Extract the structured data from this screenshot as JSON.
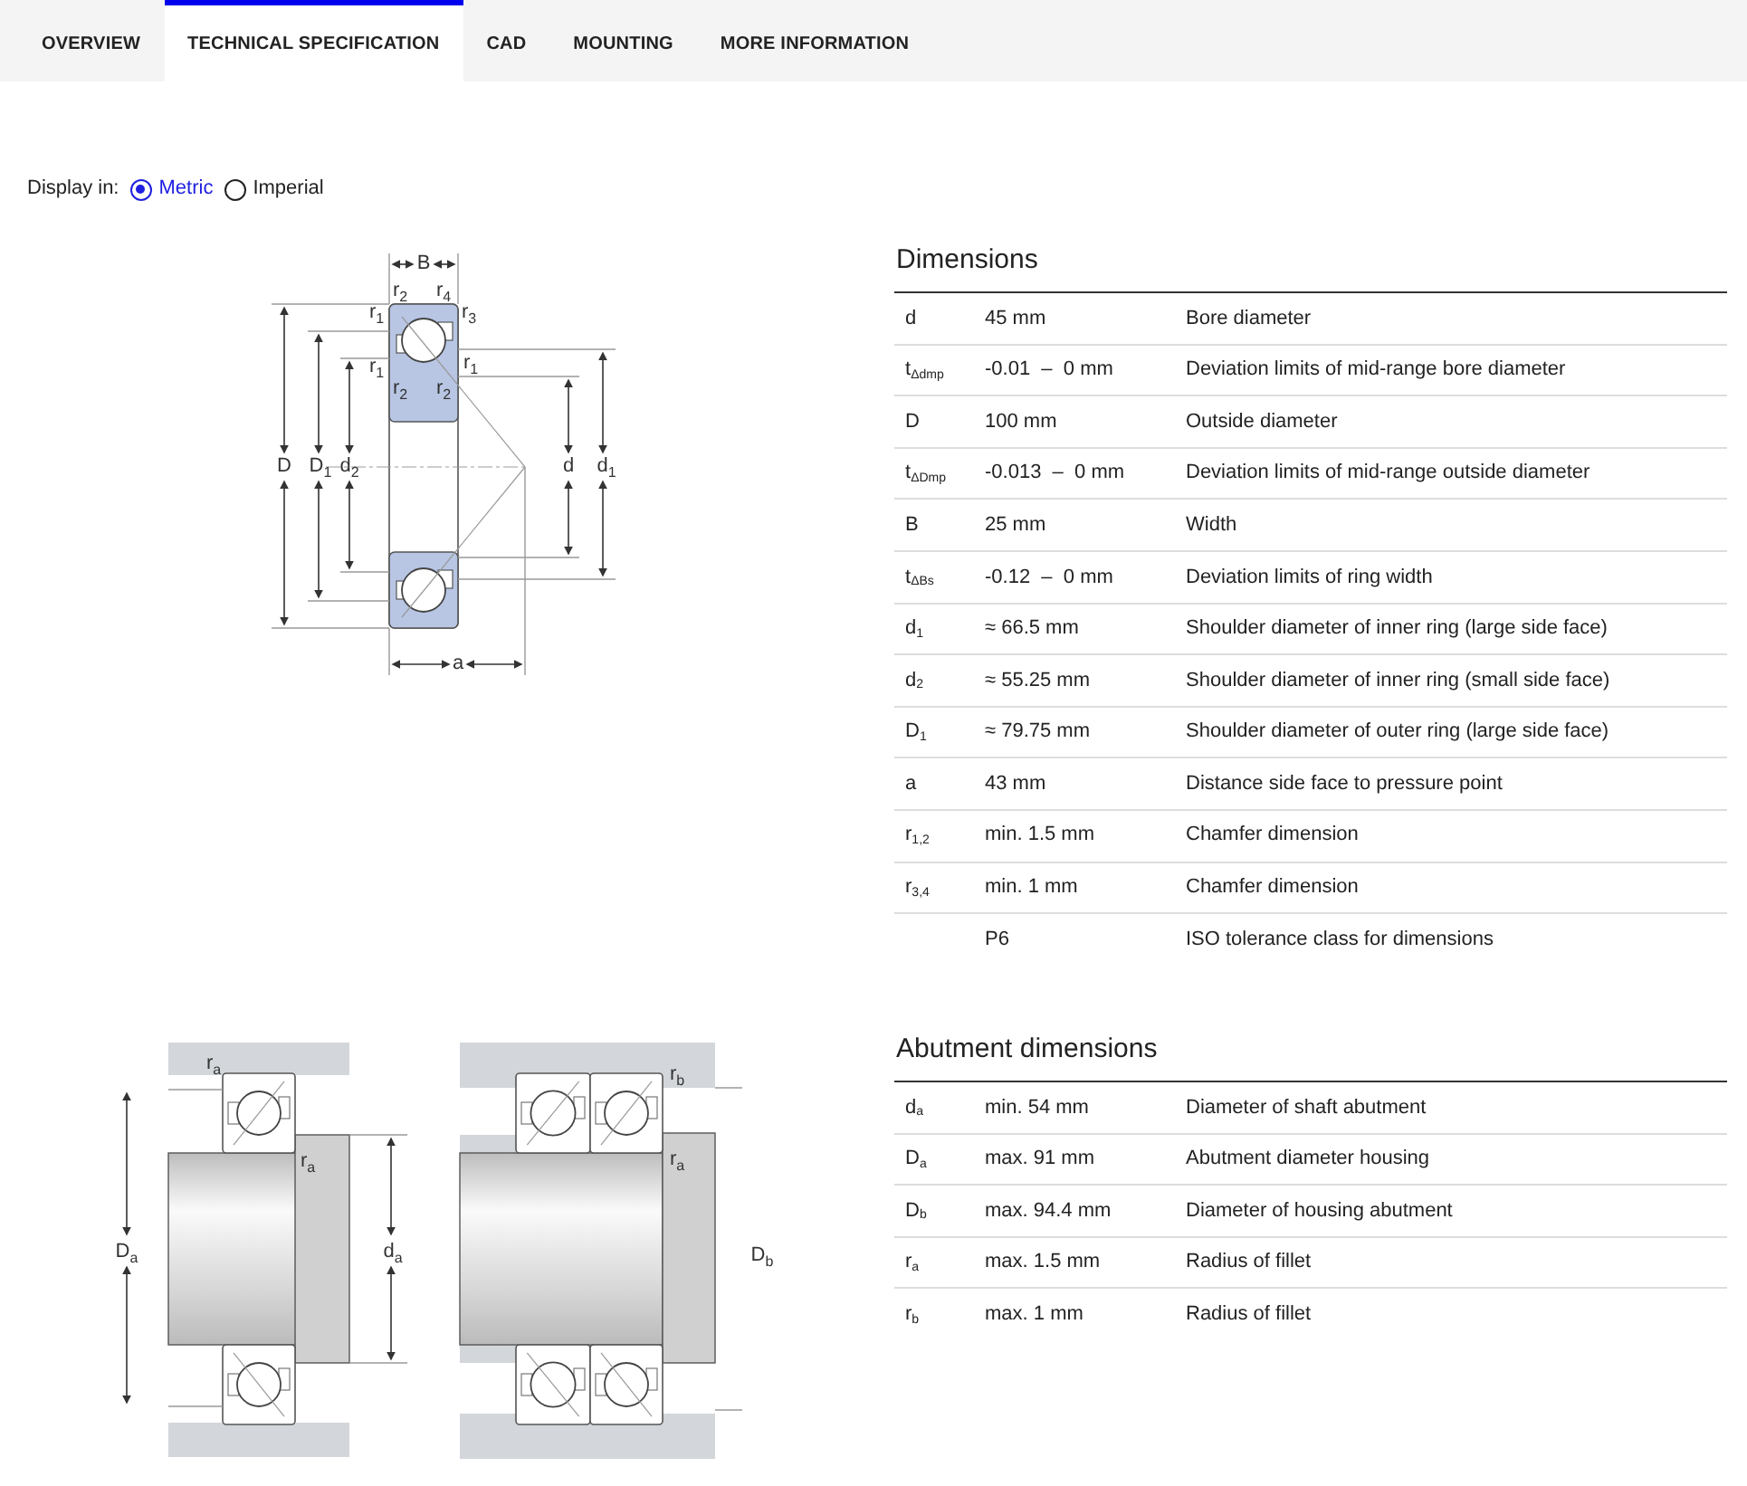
{
  "tabs": [
    {
      "label": "OVERVIEW",
      "selected": false
    },
    {
      "label": "TECHNICAL SPECIFICATION",
      "selected": true
    },
    {
      "label": "CAD",
      "selected": false
    },
    {
      "label": "MOUNTING",
      "selected": false
    },
    {
      "label": "MORE INFORMATION",
      "selected": false
    }
  ],
  "units": {
    "label": "Display in:",
    "options": [
      {
        "label": "Metric",
        "selected": true
      },
      {
        "label": "Imperial",
        "selected": false
      }
    ]
  },
  "bearing_drawing": {
    "labels": [
      "B",
      "r$_{2}$",
      "r$_{4}$",
      "r$_{1}$",
      "r$_{3}$",
      "r$_{1}$",
      "r$_{1}$",
      "r$_{2}$",
      "r$_{2}$",
      "D",
      "D$_{1}$",
      "d$_{2}$",
      "d",
      "d$_{1}$",
      "a"
    ]
  },
  "dimensions": {
    "title": "Dimensions",
    "rows": [
      {
        "symbol": "d",
        "value": "45 mm",
        "description": "Bore diameter"
      },
      {
        "symbol": "t$_{Δdmp}$",
        "value": "-0.01  –  0 mm",
        "description": "Deviation limits of mid-range bore diameter"
      },
      {
        "symbol": "D",
        "value": "100 mm",
        "description": "Outside diameter"
      },
      {
        "symbol": "t$_{ΔDmp}$",
        "value": "-0.013  –  0 mm",
        "description": "Deviation limits of mid-range outside diameter"
      },
      {
        "symbol": "B",
        "value": "25 mm",
        "description": "Width"
      },
      {
        "symbol": "t$_{ΔBs}$",
        "value": "-0.12  –  0 mm",
        "description": "Deviation limits of ring width"
      },
      {
        "symbol": "d$_{1}$",
        "value": "≈ 66.5 mm",
        "description": "Shoulder diameter of inner ring (large side face)"
      },
      {
        "symbol": "d$_{2}$",
        "value": "≈ 55.25 mm",
        "description": "Shoulder diameter of inner ring (small side face)"
      },
      {
        "symbol": "D$_{1}$",
        "value": "≈ 79.75 mm",
        "description": "Shoulder diameter of outer ring (large side face)"
      },
      {
        "symbol": "a",
        "value": "43 mm",
        "description": "Distance side face to pressure point"
      },
      {
        "symbol": "r$_{1,2}$",
        "value": "min. 1.5 mm",
        "description": "Chamfer dimension"
      },
      {
        "symbol": "r$_{3,4}$",
        "value": "min. 1 mm",
        "description": "Chamfer dimension"
      },
      {
        "symbol": "",
        "value": "P6",
        "description": "ISO tolerance class for dimensions"
      }
    ]
  },
  "abutment_drawing": {
    "labels": [
      "r$_{a}$",
      "r$_{a}$",
      "D$_{a}$",
      "d$_{a}$",
      "r$_{b}$",
      "r$_{a}$",
      "D$_{b}$"
    ]
  },
  "abutment": {
    "title": "Abutment dimensions",
    "rows": [
      {
        "symbol": "d$_{a}$",
        "value": "min. 54 mm",
        "description": "Diameter of shaft abutment"
      },
      {
        "symbol": "D$_{a}$",
        "value": "max. 91 mm",
        "description": "Abutment diameter housing"
      },
      {
        "symbol": "D$_{b}$",
        "value": "max. 94.4 mm",
        "description": "Diameter of housing abutment"
      },
      {
        "symbol": "r$_{a}$",
        "value": "max. 1.5 mm",
        "description": "Radius of fillet"
      },
      {
        "symbol": "r$_{b}$",
        "value": "max. 1 mm",
        "description": "Radius of fillet"
      }
    ]
  }
}
